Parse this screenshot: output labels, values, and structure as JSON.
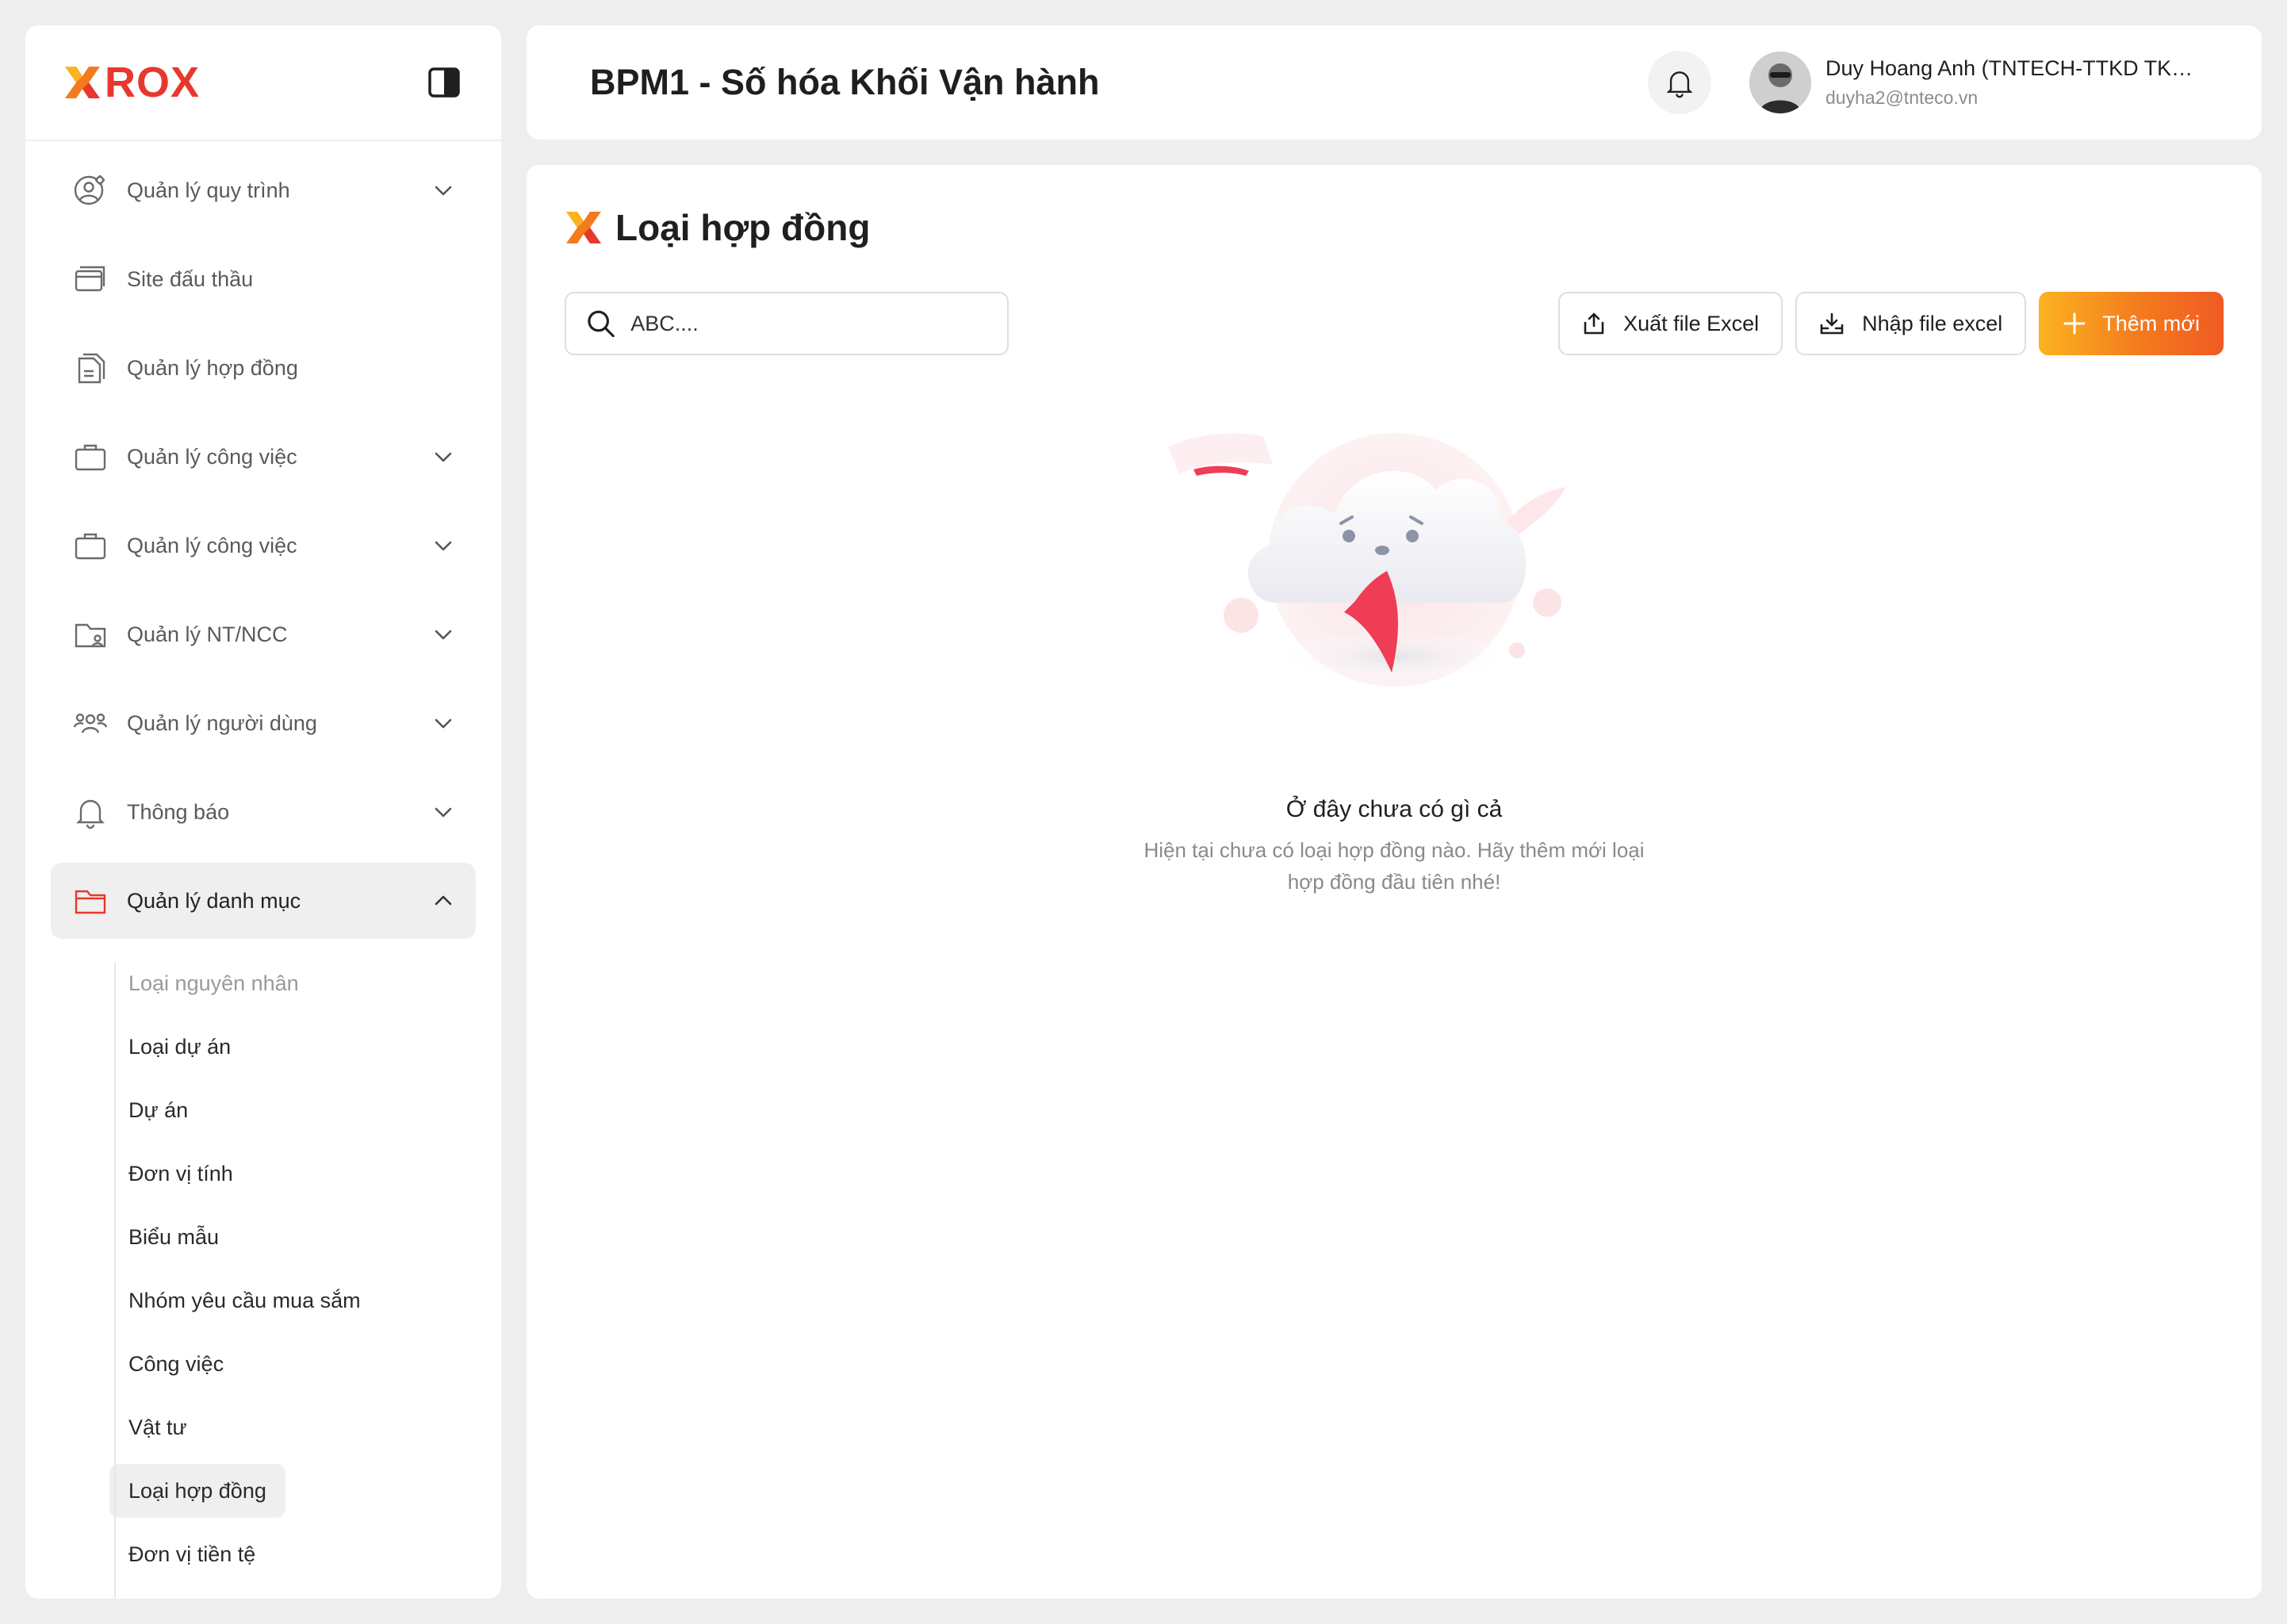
{
  "brand": {
    "logo_text": "ROX"
  },
  "sidebar": {
    "items": [
      {
        "label": "Quản lý quy trình",
        "icon": "user-gear-icon",
        "expandable": true
      },
      {
        "label": "Site đấu thầu",
        "icon": "cards-icon",
        "expandable": false
      },
      {
        "label": "Quản lý hợp đồng",
        "icon": "document-icon",
        "expandable": false
      },
      {
        "label": "Quản lý công việc",
        "icon": "briefcase-icon",
        "expandable": true
      },
      {
        "label": "Quản lý công việc",
        "icon": "briefcase-icon",
        "expandable": true
      },
      {
        "label": "Quản lý NT/NCC",
        "icon": "folder-user-icon",
        "expandable": true
      },
      {
        "label": "Quản lý người dùng",
        "icon": "users-icon",
        "expandable": true
      },
      {
        "label": "Thông báo",
        "icon": "bell-icon",
        "expandable": true
      },
      {
        "label": "Quản lý danh mục",
        "icon": "folder-icon",
        "expandable": true,
        "expanded": true
      }
    ],
    "subitems": [
      "Loại nguyên nhân",
      "Loại dự án",
      "Dự án",
      "Đơn vị tính",
      "Biểu mẫu",
      "Nhóm yêu cầu mua sắm",
      "Công việc",
      "Vật tư",
      "Loại hợp đồng",
      "Đơn vị tiền tệ"
    ],
    "active_subitem": "Loại hợp đồng"
  },
  "header": {
    "title": "BPM1 - Số hóa Khối Vận hành",
    "user": {
      "name": "Duy Hoang Anh (TNTECH-TTKD TKT...",
      "email": "duyha2@tnteco.vn"
    }
  },
  "page": {
    "title": "Loại hợp đồng",
    "search": {
      "value": "ABC...."
    },
    "buttons": {
      "export": "Xuất file Excel",
      "import": "Nhập file excel",
      "add": "Thêm mới"
    },
    "empty": {
      "title": "Ở đây chưa có gì cả",
      "description": "Hiện tại chưa có loại hợp đồng nào. Hãy thêm mới loại hợp đồng đầu tiên nhé!"
    }
  },
  "colors": {
    "brand_orange": "#f47a1e",
    "brand_red": "#e8372d",
    "accent_gradient_start": "#fbb321",
    "accent_gradient_end": "#ef5a22"
  }
}
